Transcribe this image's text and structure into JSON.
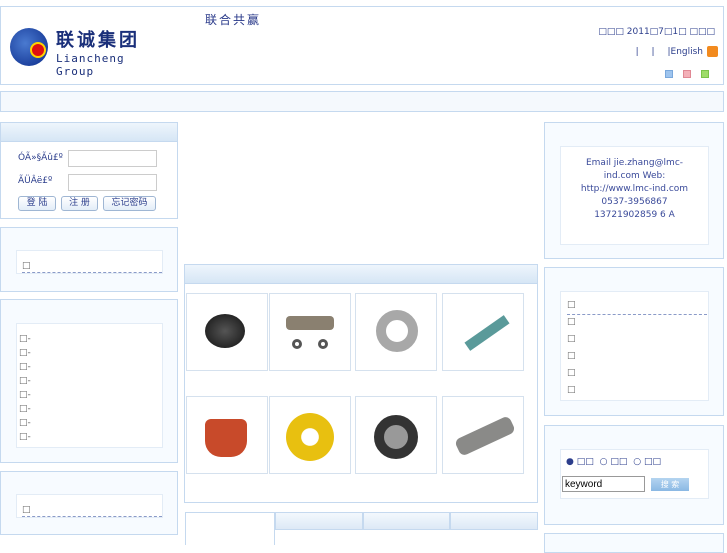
{
  "header": {
    "logo_cn": "联诚集团",
    "logo_en": "Liancheng Group",
    "slogan": "联合共赢",
    "date": "□□□ 2011□7□1□ □□□",
    "links": [
      "|",
      "|",
      "|English"
    ]
  },
  "login": {
    "username_label": "ÓÃ»§Ãû£º",
    "password_label": "ÃÜÂë£º",
    "login_btn": "登 陆",
    "register_btn": "注 册",
    "forgot_btn": "忘记密码"
  },
  "left_lists": {
    "box2_items": [
      "□"
    ],
    "box3_items": [
      "□-",
      "□-",
      "□-",
      "□-",
      "□-",
      "□-",
      "□-",
      "□-"
    ],
    "box4_items": [
      "□"
    ]
  },
  "contact": {
    "text": "Email jie.zhang@lmc-ind.com Web: http://www.lmc-ind.com 0537-3956867 13721902859 6 A"
  },
  "right_list": {
    "items": [
      "□",
      "□",
      "□",
      "□",
      "□",
      "□"
    ]
  },
  "search": {
    "options": [
      "□□",
      "□□",
      "□□"
    ],
    "selected": 0,
    "keyword": "keyword",
    "button": "搜 索"
  },
  "colors": {
    "border": "#c5d9ef",
    "text": "#2c3e8c"
  }
}
